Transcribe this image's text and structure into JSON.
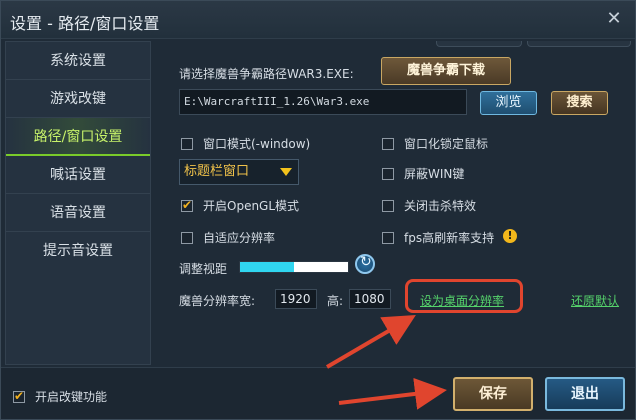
{
  "window": {
    "title": "设置 - 路径/窗口设置"
  },
  "sidebar": {
    "items": [
      {
        "label": "系统设置",
        "active": false
      },
      {
        "label": "游戏改键",
        "active": false
      },
      {
        "label": "路径/窗口设置",
        "active": true
      },
      {
        "label": "喊话设置",
        "active": false
      },
      {
        "label": "语音设置",
        "active": false
      },
      {
        "label": "提示音设置",
        "active": false
      }
    ]
  },
  "path_section": {
    "prompt": "请选择魔兽争霸路径WAR3.EXE:",
    "download_label": "魔兽争霸下载",
    "path_value": "E:\\WarcraftIII_1.26\\War3.exe",
    "browse_label": "浏览",
    "search_label": "搜索"
  },
  "options": {
    "window_mode": {
      "label": "窗口模式(-window)",
      "checked": false
    },
    "lock_mouse": {
      "label": "窗口化锁定鼠标",
      "checked": false
    },
    "window_style": {
      "value": "标题栏窗口"
    },
    "block_win": {
      "label": "屏蔽WIN键",
      "checked": false
    },
    "opengl": {
      "label": "开启OpenGL模式",
      "checked": true
    },
    "disable_kill_fx": {
      "label": "关闭击杀特效",
      "checked": false
    },
    "auto_resolution": {
      "label": "自适应分辨率",
      "checked": false
    },
    "fps_high_refresh": {
      "label": "fps高刷新率支持",
      "checked": false
    }
  },
  "view_distance": {
    "label": "调整视距",
    "level": 0.5
  },
  "resolution": {
    "width_label": "魔兽分辨率宽:",
    "width_value": "1920",
    "height_label": "高:",
    "height_value": "1080",
    "desktop_link": "设为桌面分辨率",
    "restore_link": "还原默认"
  },
  "footer": {
    "enable_keymap_label": "开启改键功能",
    "enable_keymap_checked": true,
    "save_label": "保存",
    "exit_label": "退出"
  },
  "colors": {
    "accent_green": "#7acb2a",
    "highlight_red": "#e0452e",
    "link_green": "#55d36b",
    "slider_cyan": "#30d6f0"
  }
}
